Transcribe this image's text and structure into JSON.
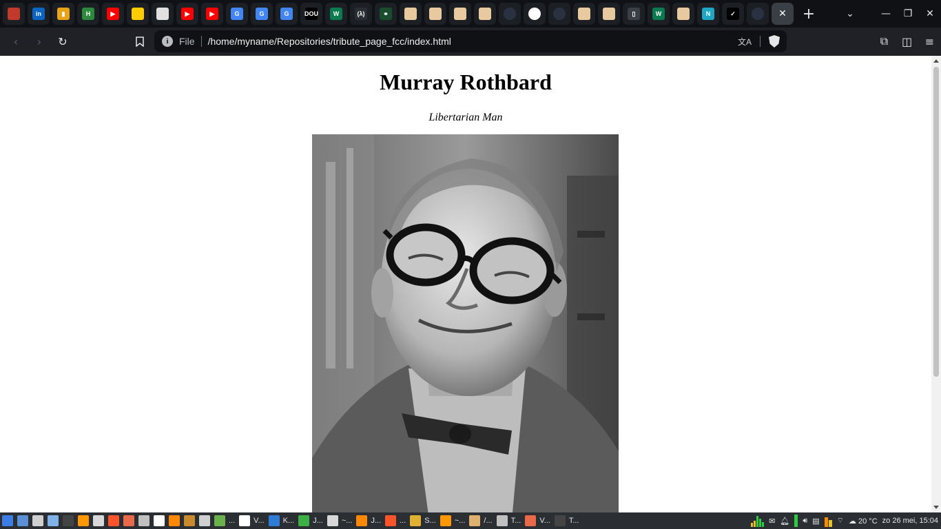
{
  "tabs": [
    {
      "icon": "red-app-icon",
      "color": "#c0392b",
      "glyph": ""
    },
    {
      "icon": "linkedin-icon",
      "color": "#0a66c2",
      "glyph": "in"
    },
    {
      "icon": "trello-icon",
      "color": "#e8a317",
      "glyph": "▮"
    },
    {
      "icon": "habr-icon",
      "color": "#2b8a3e",
      "glyph": "H"
    },
    {
      "icon": "youtube-icon",
      "color": "#ff0000",
      "glyph": "▶"
    },
    {
      "icon": "national-geographic-icon",
      "color": "#ffcc00",
      "glyph": ""
    },
    {
      "icon": "generic-page-icon",
      "color": "#e0e0e0",
      "glyph": ""
    },
    {
      "icon": "youtube-icon",
      "color": "#ff0000",
      "glyph": "▶"
    },
    {
      "icon": "youtube-icon",
      "color": "#ff0000",
      "glyph": "▶"
    },
    {
      "icon": "google-translate-icon",
      "color": "#4285f4",
      "glyph": "G"
    },
    {
      "icon": "google-translate-icon",
      "color": "#4285f4",
      "glyph": "G"
    },
    {
      "icon": "google-translate-icon",
      "color": "#4285f4",
      "glyph": "G"
    },
    {
      "icon": "dou-icon",
      "color": "#000000",
      "glyph": "DOU"
    },
    {
      "icon": "wellfound-icon",
      "color": "#0b7b4f",
      "glyph": "W"
    },
    {
      "icon": "lambda-icon",
      "color": "#2a2d33",
      "glyph": "(λ)"
    },
    {
      "icon": "chain-icon",
      "color": "#1a4d2e",
      "glyph": "⚭"
    },
    {
      "icon": "unicorn-icon",
      "color": "#e8c9a0",
      "glyph": ""
    },
    {
      "icon": "unicorn-icon",
      "color": "#e8c9a0",
      "glyph": ""
    },
    {
      "icon": "unicorn-icon",
      "color": "#e8c9a0",
      "glyph": ""
    },
    {
      "icon": "unicorn-icon",
      "color": "#e8c9a0",
      "glyph": ""
    },
    {
      "icon": "globe-icon",
      "color": "#2a3140",
      "glyph": ""
    },
    {
      "icon": "github-icon",
      "color": "#ffffff",
      "glyph": ""
    },
    {
      "icon": "globe-icon",
      "color": "#2a3140",
      "glyph": ""
    },
    {
      "icon": "unicorn-icon",
      "color": "#e8c9a0",
      "glyph": ""
    },
    {
      "icon": "unicorn-icon",
      "color": "#e8c9a0",
      "glyph": ""
    },
    {
      "icon": "book-icon",
      "color": "#3a3f46",
      "glyph": "▯"
    },
    {
      "icon": "wellfound-icon",
      "color": "#0b7b4f",
      "glyph": "W"
    },
    {
      "icon": "unicorn-icon",
      "color": "#e8c9a0",
      "glyph": ""
    },
    {
      "icon": "n-app-icon",
      "color": "#1ea7c5",
      "glyph": "N"
    },
    {
      "icon": "check-app-icon",
      "color": "#000000",
      "glyph": "✓"
    },
    {
      "icon": "globe-icon",
      "color": "#2a3140",
      "glyph": ""
    }
  ],
  "active_tab": {
    "icon": "close-icon",
    "glyph": "✕"
  },
  "new_tab_glyph": "+",
  "window_controls": {
    "tab_list": "⌄",
    "minimize": "—",
    "restore": "❐",
    "close": "✕"
  },
  "toolbar": {
    "back": "‹",
    "forward": "›",
    "reload": "↻",
    "bookmark": "🔖"
  },
  "urlbar": {
    "info_glyph": "i",
    "scheme": "File",
    "path": "/home/myname/Repositories/tribute_page_fcc/index.html",
    "translate_glyph": "文A"
  },
  "toolbar_right": {
    "extensions": "⧉",
    "sidebar": "◫",
    "menu": "≡"
  },
  "page": {
    "title": "Murray Rothbard",
    "subtitle": "Libertarian Man"
  },
  "taskbar": {
    "items": [
      {
        "icon": "kde-start-icon",
        "color": "#3d7ee6",
        "label": ""
      },
      {
        "icon": "desktop-icon",
        "color": "#5b8fd6",
        "label": ""
      },
      {
        "icon": "clipboard-icon",
        "color": "#d0d0d0",
        "label": ""
      },
      {
        "icon": "folder-icon",
        "color": "#7fb3e8",
        "label": ""
      },
      {
        "icon": "terminal-icon",
        "color": "#444444",
        "label": ""
      },
      {
        "icon": "sublime-icon",
        "color": "#ff9800",
        "label": ""
      },
      {
        "icon": "editor-icon",
        "color": "#d8d8d8",
        "label": ""
      },
      {
        "icon": "brave-icon",
        "color": "#fb542b",
        "label": ""
      },
      {
        "icon": "image-viewer-icon",
        "color": "#e86a4a",
        "label": ""
      },
      {
        "icon": "app-store-icon",
        "color": "#c0c0c0",
        "label": ""
      },
      {
        "icon": "q-app-icon",
        "color": "#ffffff",
        "label": ""
      },
      {
        "icon": "vlc-icon",
        "color": "#ff8800",
        "label": ""
      },
      {
        "icon": "package-icon",
        "color": "#c98a2e",
        "label": ""
      },
      {
        "icon": "calculator-icon",
        "color": "#d0d0d0",
        "label": ""
      },
      {
        "icon": "monitor-icon",
        "color": "#6ab04c",
        "label": "..."
      },
      {
        "icon": "document-icon",
        "color": "#ffffff",
        "label": "V..."
      },
      {
        "icon": "writer-icon",
        "color": "#2e7cd6",
        "label": "K..."
      },
      {
        "icon": "calc-sheet-icon",
        "color": "#3cb043",
        "label": "J..."
      },
      {
        "icon": "editor-icon",
        "color": "#d8d8d8",
        "label": "~..."
      },
      {
        "icon": "vlc-icon",
        "color": "#ff8800",
        "label": "J..."
      },
      {
        "icon": "brave-icon",
        "color": "#fb542b",
        "label": "..."
      },
      {
        "icon": "package-icon",
        "color": "#e0b030",
        "label": "S..."
      },
      {
        "icon": "sublime-icon",
        "color": "#ff9800",
        "label": "~..."
      },
      {
        "icon": "folder-icon",
        "color": "#e0b070",
        "label": "/..."
      },
      {
        "icon": "app-store-icon",
        "color": "#c0c0c0",
        "label": "T..."
      },
      {
        "icon": "image-viewer-icon",
        "color": "#e86a4a",
        "label": "V..."
      },
      {
        "icon": "terminal-icon",
        "color": "#444444",
        "label": "T..."
      }
    ],
    "tray": {
      "datetime": "zo 26 mei, 15:04",
      "temperature": "20 °C"
    }
  },
  "colors": {
    "tabstrip_bg": "#0f1114",
    "toolbar_bg": "#1f2126",
    "taskbar_bg": "#2b2e33"
  }
}
